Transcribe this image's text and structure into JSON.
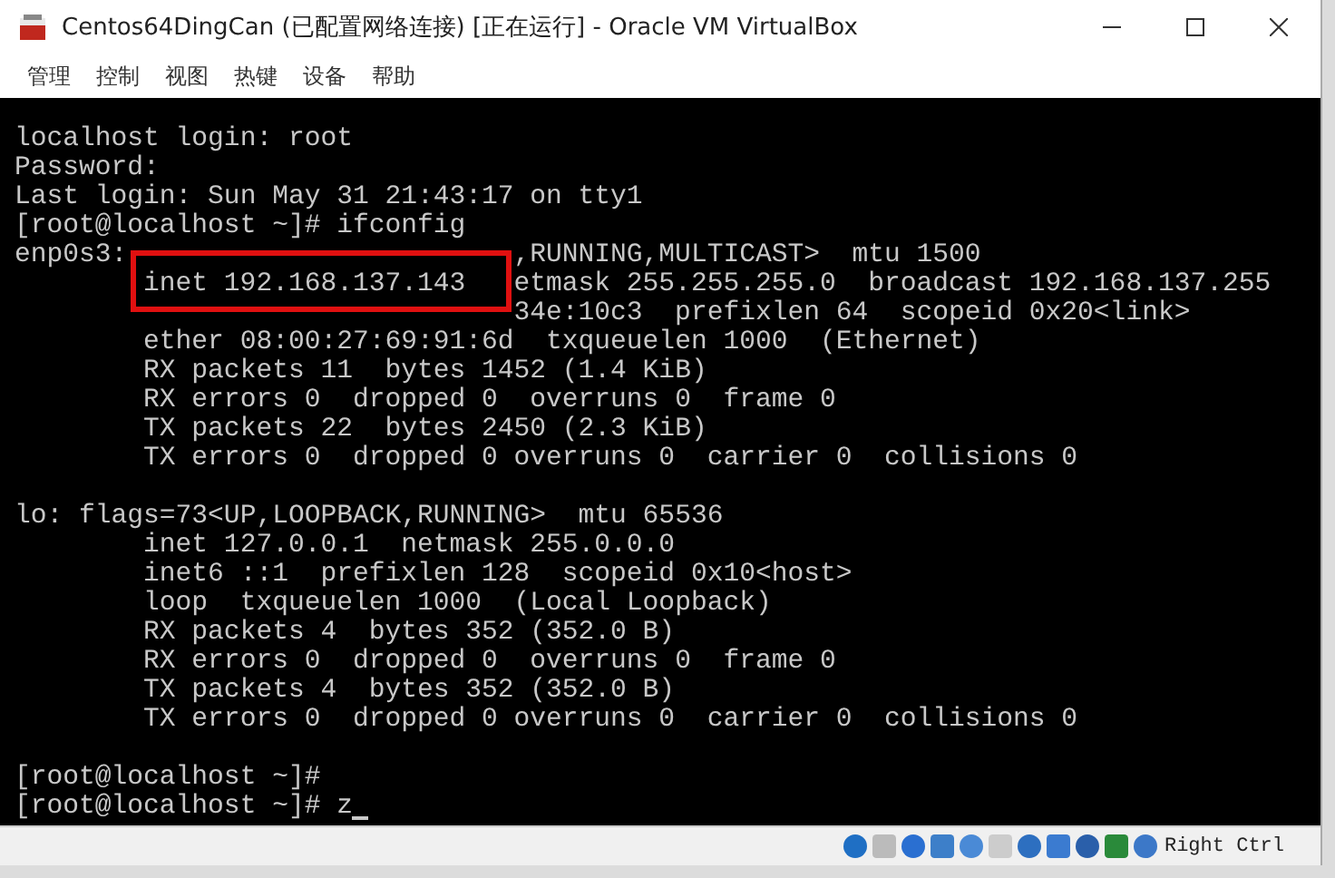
{
  "window": {
    "title": "Centos64DingCan (已配置网络连接) [正在运行] - Oracle VM VirtualBox"
  },
  "menu": [
    "管理",
    "控制",
    "视图",
    "热键",
    "设备",
    "帮助"
  ],
  "terminal": {
    "blocks": [
      [
        {
          "text": "localhost login: root"
        },
        {
          "text": "Password:"
        },
        {
          "text": "Last login: Sun May 31 21:43:17 on tty1"
        },
        {
          "text": "[root@localhost ~]# ifconfig"
        },
        {
          "parts": [
            {
              "text": "enp0s3:",
              "in_box": false,
              "after_box": false
            },
            {
              "text": ",RUNNING,MULTICAST>  mtu 1500",
              "in_box": false,
              "after_box": true
            }
          ]
        },
        {
          "parts": [
            {
              "text": "inet 192.168.137.143",
              "in_box": true,
              "after_box": false
            },
            {
              "text": "etmask 255.255.255.0  broadcast 192.168.137.255",
              "in_box": false,
              "after_box": true
            }
          ]
        },
        {
          "parts": [
            {
              "text": "34e:10c3  prefixlen 64  scopeid 0x20<link>",
              "in_box": false,
              "after_box": true
            }
          ]
        },
        {
          "text": "        ether 08:00:27:69:91:6d  txqueuelen 1000  (Ethernet)"
        },
        {
          "text": "        RX packets 11  bytes 1452 (1.4 KiB)"
        },
        {
          "text": "        RX errors 0  dropped 0  overruns 0  frame 0"
        },
        {
          "text": "        TX packets 22  bytes 2450 (2.3 KiB)"
        },
        {
          "text": "        TX errors 0  dropped 0 overruns 0  carrier 0  collisions 0"
        }
      ],
      [
        {
          "text": "lo: flags=73<UP,LOOPBACK,RUNNING>  mtu 65536"
        },
        {
          "text": "        inet 127.0.0.1  netmask 255.0.0.0"
        },
        {
          "text": "        inet6 ::1  prefixlen 128  scopeid 0x10<host>"
        },
        {
          "text": "        loop  txqueuelen 1000  (Local Loopback)"
        },
        {
          "text": "        RX packets 4  bytes 352 (352.0 B)"
        },
        {
          "text": "        RX errors 0  dropped 0  overruns 0  frame 0"
        },
        {
          "text": "        TX packets 4  bytes 352 (352.0 B)"
        },
        {
          "text": "        TX errors 0  dropped 0 overruns 0  carrier 0  collisions 0"
        }
      ],
      [
        {
          "text": "[root@localhost ~]#"
        },
        {
          "text": "[root@localhost ~]# z"
        }
      ]
    ],
    "cursor": true
  },
  "status_bar": {
    "host_key": "Right Ctrl"
  }
}
